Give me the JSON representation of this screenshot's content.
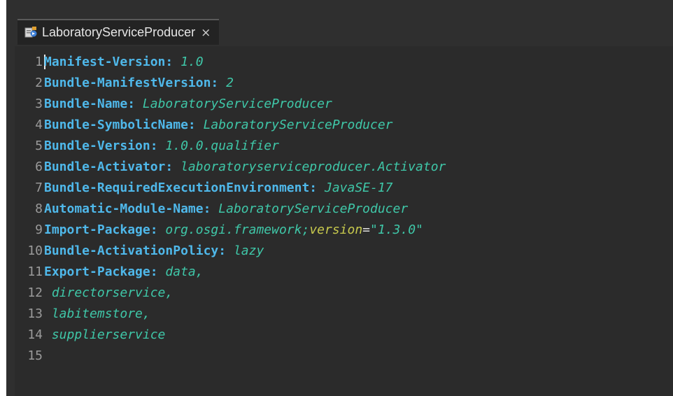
{
  "tab": {
    "title": "LaboratoryServiceProducer",
    "icon": "manifest-file-icon",
    "close_glyph": "×"
  },
  "colors": {
    "key": "#4fb8ea",
    "value": "#3fc7a8",
    "attribute": "#c7c94d",
    "line_number": "#9a9a9a",
    "background": "#2b2b2b"
  },
  "editor": {
    "lines": [
      {
        "num": "1",
        "key": "Manifest-Version",
        "value": "1.0"
      },
      {
        "num": "2",
        "key": "Bundle-ManifestVersion",
        "value": "2"
      },
      {
        "num": "3",
        "key": "Bundle-Name",
        "value": "LaboratoryServiceProducer"
      },
      {
        "num": "4",
        "key": "Bundle-SymbolicName",
        "value": "LaboratoryServiceProducer"
      },
      {
        "num": "5",
        "key": "Bundle-Version",
        "value": "1.0.0.qualifier"
      },
      {
        "num": "6",
        "key": "Bundle-Activator",
        "value": "laboratoryserviceproducer.Activator"
      },
      {
        "num": "7",
        "key": "Bundle-RequiredExecutionEnvironment",
        "value": "JavaSE-17"
      },
      {
        "num": "8",
        "key": "Automatic-Module-Name",
        "value": "LaboratoryServiceProducer"
      },
      {
        "num": "9",
        "key": "Import-Package",
        "value": "org.osgi.framework;",
        "attr": "version",
        "eq": "=",
        "attr_value": "\"1.3.0\""
      },
      {
        "num": "10",
        "key": "Bundle-ActivationPolicy",
        "value": "lazy"
      },
      {
        "num": "11",
        "key": "Export-Package",
        "value": "data,"
      },
      {
        "num": "12",
        "cont": " directorservice,"
      },
      {
        "num": "13",
        "cont": " labitemstore,"
      },
      {
        "num": "14",
        "cont": " supplierservice"
      },
      {
        "num": "15",
        "cont": ""
      }
    ]
  }
}
